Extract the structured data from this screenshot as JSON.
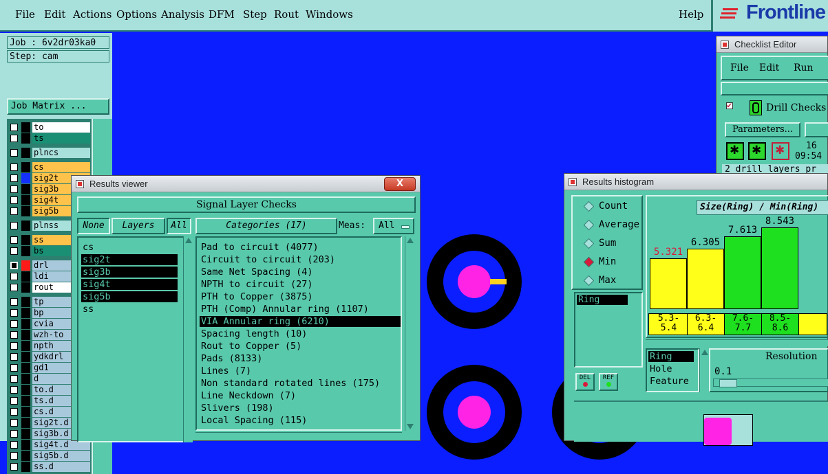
{
  "menubar": {
    "items": [
      "File",
      "Edit",
      "Actions",
      "Options",
      "Analysis",
      "DFM",
      "Step",
      "Rout",
      "Windows"
    ],
    "help": "Help",
    "logo": "Frontline"
  },
  "job": {
    "job_line": "Job : 6v2dr03ka0",
    "step_line": "Step: cam",
    "matrix_button": "Job Matrix ..."
  },
  "layers": [
    {
      "name": "to",
      "color": "#ffffff",
      "swatch": "#000000",
      "checked": false
    },
    {
      "name": "ts",
      "color": "#1a8f73",
      "swatch": "#000000",
      "checked": false
    },
    {
      "name": "plncs",
      "color": "#a8e0dc",
      "swatch": "#000000",
      "checked": false
    },
    {
      "name": "cs",
      "color": "#ffc24a",
      "swatch": "#000000",
      "checked": false
    },
    {
      "name": "sig2t",
      "color": "#ffc24a",
      "swatch": "#1430ff",
      "checked": false
    },
    {
      "name": "sig3b",
      "color": "#ffc24a",
      "swatch": "#000000",
      "checked": false
    },
    {
      "name": "sig4t",
      "color": "#ffc24a",
      "swatch": "#000000",
      "checked": false
    },
    {
      "name": "sig5b",
      "color": "#ffc24a",
      "swatch": "#000000",
      "checked": false
    },
    {
      "name": "plnss",
      "color": "#a8e0dc",
      "swatch": "#000000",
      "checked": false
    },
    {
      "name": "ss",
      "color": "#ffc24a",
      "swatch": "#000000",
      "checked": false
    },
    {
      "name": "bs",
      "color": "#1a8f73",
      "swatch": "#000000",
      "checked": false
    },
    {
      "name": "drl",
      "color": "#a8c8dc",
      "swatch": "#ff1a1a",
      "checked": true
    },
    {
      "name": "ldi",
      "color": "#a8c8dc",
      "swatch": "#000000",
      "checked": false
    },
    {
      "name": "rout",
      "color": "#ffffff",
      "swatch": "#000000",
      "checked": false
    },
    {
      "name": "tp",
      "color": "#a8c8dc",
      "swatch": "#000000",
      "checked": false
    },
    {
      "name": "bp",
      "color": "#a8c8dc",
      "swatch": "#000000",
      "checked": false
    },
    {
      "name": "cvia",
      "color": "#a8c8dc",
      "swatch": "#000000",
      "checked": false
    },
    {
      "name": "wzh-to",
      "color": "#a8c8dc",
      "swatch": "#000000",
      "checked": false
    },
    {
      "name": "npth",
      "color": "#a8c8dc",
      "swatch": "#000000",
      "checked": false
    },
    {
      "name": "ydkdrl",
      "color": "#a8c8dc",
      "swatch": "#000000",
      "checked": false
    },
    {
      "name": "gd1",
      "color": "#a8c8dc",
      "swatch": "#000000",
      "checked": false
    },
    {
      "name": "d",
      "color": "#a8c8dc",
      "swatch": "#000000",
      "checked": false
    },
    {
      "name": "to.d",
      "color": "#a8c8dc",
      "swatch": "#000000",
      "checked": false
    },
    {
      "name": "ts.d",
      "color": "#a8c8dc",
      "swatch": "#000000",
      "checked": false
    },
    {
      "name": "cs.d",
      "color": "#a8c8dc",
      "swatch": "#000000",
      "checked": false
    },
    {
      "name": "sig2t.d",
      "color": "#a8c8dc",
      "swatch": "#000000",
      "checked": false
    },
    {
      "name": "sig3b.d",
      "color": "#a8c8dc",
      "swatch": "#000000",
      "checked": false
    },
    {
      "name": "sig4t.d",
      "color": "#a8c8dc",
      "swatch": "#000000",
      "checked": false
    },
    {
      "name": "sig5b.d",
      "color": "#a8c8dc",
      "swatch": "#000000",
      "checked": false
    },
    {
      "name": "ss.d",
      "color": "#a8c8dc",
      "swatch": "#000000",
      "checked": false
    }
  ],
  "results_viewer": {
    "title": "Results viewer",
    "close": "X",
    "header": "Signal Layer Checks",
    "none_button": "None",
    "layers_label": "Layers",
    "all_button": "All",
    "categories_label": "Categories (17)",
    "meas_label": "Meas:",
    "meas_value": "All",
    "layers": [
      {
        "name": "cs",
        "selected": false
      },
      {
        "name": "sig2t",
        "selected": true
      },
      {
        "name": "sig3b",
        "selected": true
      },
      {
        "name": "sig4t",
        "selected": true
      },
      {
        "name": "sig5b",
        "selected": true
      },
      {
        "name": "ss",
        "selected": false
      }
    ],
    "categories": [
      {
        "label": "Pad to circuit (4077)",
        "selected": false
      },
      {
        "label": "Circuit to circuit (203)",
        "selected": false
      },
      {
        "label": "Same Net Spacing (4)",
        "selected": false
      },
      {
        "label": "NPTH to circuit (27)",
        "selected": false
      },
      {
        "label": "PTH to Copper (3875)",
        "selected": false
      },
      {
        "label": "PTH (Comp) Annular ring (1107)",
        "selected": false
      },
      {
        "label": "VIA Annular ring (6210)",
        "selected": true
      },
      {
        "label": "Spacing length (10)",
        "selected": false
      },
      {
        "label": "Rout to Copper (5)",
        "selected": false
      },
      {
        "label": "Pads (8133)",
        "selected": false
      },
      {
        "label": "Lines (7)",
        "selected": false
      },
      {
        "label": "Non standard rotated lines (175)",
        "selected": false
      },
      {
        "label": "Line Neckdown (7)",
        "selected": false
      },
      {
        "label": "Slivers (198)",
        "selected": false
      },
      {
        "label": "Local Spacing (115)",
        "selected": false
      }
    ]
  },
  "checklist_editor": {
    "title": "Checklist Editor",
    "menu": [
      "File",
      "Edit",
      "Run"
    ],
    "check_name": "Drill Checks",
    "parameters": "Parameters...",
    "date_fragment": "16",
    "time": "09:54",
    "status": "2 drill layers pr"
  },
  "histogram": {
    "title": "Results histogram",
    "modes": [
      {
        "label": "Count",
        "selected": false
      },
      {
        "label": "Average",
        "selected": false
      },
      {
        "label": "Sum",
        "selected": false
      },
      {
        "label": "Min",
        "selected": true
      },
      {
        "label": "Max",
        "selected": false
      }
    ],
    "ring_list": [
      "Ring"
    ],
    "del_button": "DEL",
    "ref_button": "REF",
    "chart_title": "Size(Ring) / Min(Ring)",
    "attr_list": [
      "Ring",
      "Hole",
      "Feature"
    ],
    "resolution_label": "Resolution",
    "resolution_value": "0.1"
  },
  "chart_data": {
    "type": "bar",
    "title": "Size(Ring) / Min(Ring)",
    "categories": [
      "5.3-5.4",
      "6.3-6.4",
      "7.6-7.7",
      "8.5-8.6"
    ],
    "category_lines": [
      [
        "5.3-",
        "5.4"
      ],
      [
        "6.3-",
        "6.4"
      ],
      [
        "7.6-",
        "7.7"
      ],
      [
        "8.5-",
        "8.6"
      ]
    ],
    "values": [
      5.321,
      6.305,
      7.613,
      8.543
    ],
    "value_labels": [
      "5.321",
      "6.305",
      "7.613",
      "8.543"
    ],
    "colors": [
      "#ffff19",
      "#ffff19",
      "#1fe01f",
      "#1fe01f"
    ],
    "ylim": [
      0,
      9.2
    ]
  }
}
